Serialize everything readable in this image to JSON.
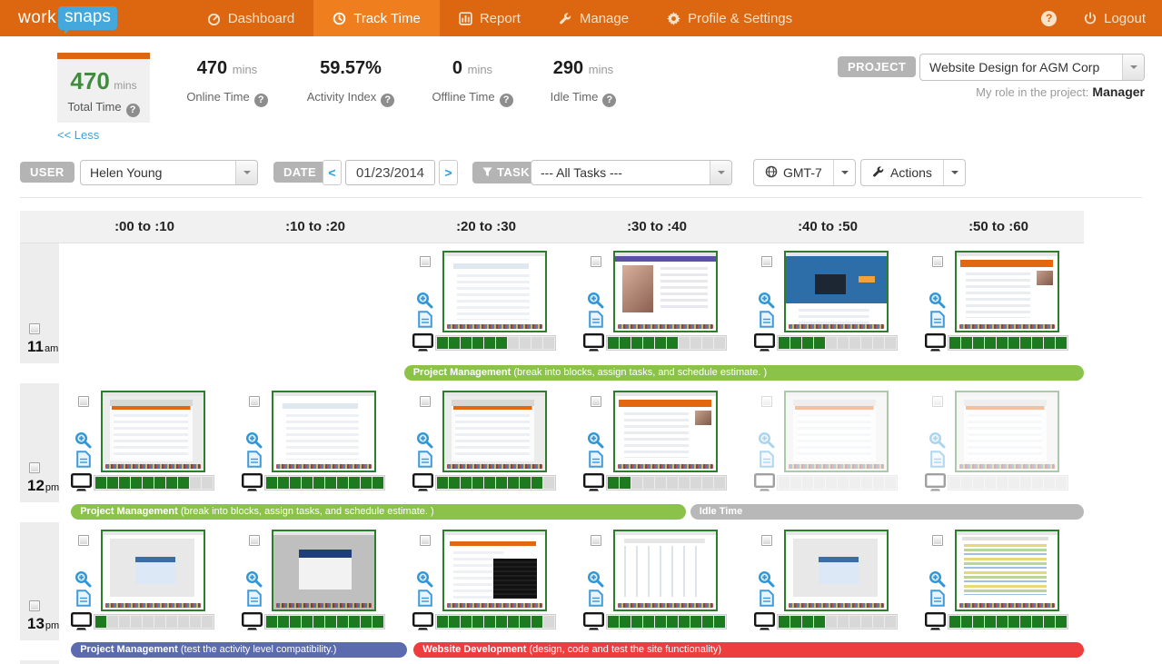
{
  "nav": {
    "logo_part1": "work",
    "logo_part2": "snaps",
    "items": [
      {
        "label": "Dashboard",
        "active": false
      },
      {
        "label": "Track Time",
        "active": true
      },
      {
        "label": "Report",
        "active": false
      },
      {
        "label": "Manage",
        "active": false
      },
      {
        "label": "Profile & Settings",
        "active": false
      }
    ],
    "logout_label": "Logout"
  },
  "stats": {
    "total": {
      "value": "470",
      "unit": "mins",
      "label": "Total Time"
    },
    "less_link": "<< Less",
    "metrics": [
      {
        "value": "470",
        "unit": "mins",
        "label": "Online Time"
      },
      {
        "value": "59.57%",
        "unit": "",
        "label": "Activity Index"
      },
      {
        "value": "0",
        "unit": "mins",
        "label": "Offline Time"
      },
      {
        "value": "290",
        "unit": "mins",
        "label": "Idle Time"
      }
    ],
    "project": {
      "badge": "PROJECT",
      "selected": "Website Design for AGM Corp",
      "role_label": "My role in the project:",
      "role_value": "Manager"
    }
  },
  "filters": {
    "user": {
      "badge": "USER",
      "selected": "Helen Young"
    },
    "date": {
      "badge": "DATE",
      "value": "01/23/2014",
      "prev": "<",
      "next": ">"
    },
    "task": {
      "badge": "TASK",
      "selected": "--- All Tasks ---"
    },
    "timezone_button": "GMT-7",
    "actions_button": "Actions"
  },
  "grid": {
    "columns": [
      ":00 to :10",
      ":10 to :20",
      ":20 to :30",
      ":30 to :40",
      ":40 to :50",
      ":50 to :60"
    ],
    "segments_per_cell": 10,
    "rows": [
      {
        "hour": "11",
        "meridiem": "am",
        "cells": [
          null,
          null,
          {
            "activity": 6,
            "thumb": "web-list",
            "idle": false
          },
          {
            "activity": 6,
            "thumb": "video",
            "idle": false
          },
          {
            "activity": 4,
            "thumb": "blue-hero",
            "idle": false
          },
          {
            "activity": 10,
            "thumb": "orange-app",
            "idle": false
          }
        ],
        "bars": [
          {
            "title": "Project Management",
            "desc": "(break into blocks, assign tasks, and schedule estimate. )",
            "color": "#8bc34a",
            "left_pct": 36.1,
            "width_pct": 63.9
          }
        ]
      },
      {
        "hour": "12",
        "meridiem": "pm",
        "cells": [
          {
            "activity": 8,
            "thumb": "desktop-list",
            "idle": false
          },
          {
            "activity": 10,
            "thumb": "web-list",
            "idle": false
          },
          {
            "activity": 9,
            "thumb": "desktop-list",
            "idle": false
          },
          {
            "activity": 2,
            "thumb": "orange-app",
            "idle": false
          },
          {
            "activity": 0,
            "thumb": "desktop-list",
            "idle": true
          },
          {
            "activity": 0,
            "thumb": "desktop-list",
            "idle": true
          }
        ],
        "bars": [
          {
            "title": "Project Management",
            "desc": "(break into blocks, assign tasks, and schedule estimate. )",
            "color": "#8bc34a",
            "left_pct": 4.8,
            "width_pct": 57.8
          },
          {
            "title": "Idle Time",
            "desc": "",
            "color": "#b8b8b8",
            "left_pct": 63.0,
            "width_pct": 37.0
          }
        ]
      },
      {
        "hour": "13",
        "meridiem": "pm",
        "cells": [
          {
            "activity": 1,
            "thumb": "dialog-blue",
            "idle": false
          },
          {
            "activity": 10,
            "thumb": "win-blue",
            "idle": false
          },
          {
            "activity": 9,
            "thumb": "terminal",
            "idle": false
          },
          {
            "activity": 10,
            "thumb": "gantt",
            "idle": false
          },
          {
            "activity": 4,
            "thumb": "dialog-blue",
            "idle": false
          },
          {
            "activity": 10,
            "thumb": "code",
            "idle": false
          }
        ],
        "bars": [
          {
            "title": "Project Management",
            "desc": "(test the activity level compatibility.)",
            "color": "#5b6bae",
            "left_pct": 4.8,
            "width_pct": 31.6
          },
          {
            "title": "Website Development",
            "desc": "(design, code and test the site functionality)",
            "color": "#ee3d3d",
            "left_pct": 37.0,
            "width_pct": 63.0
          }
        ]
      }
    ]
  }
}
